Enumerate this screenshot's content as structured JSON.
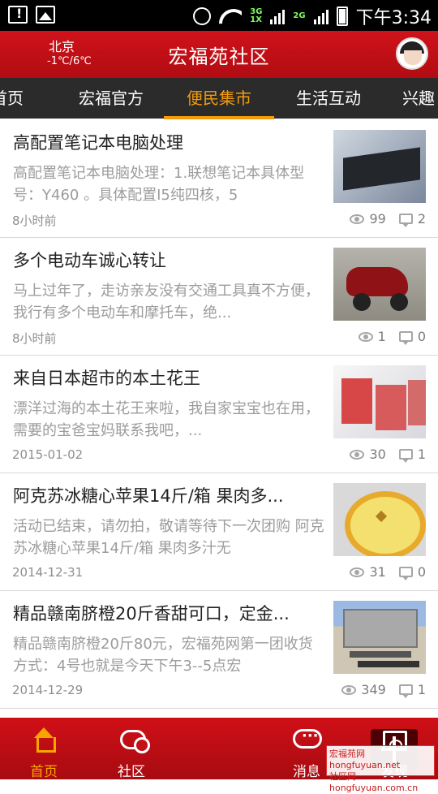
{
  "status_bar": {
    "time": "下午3:34",
    "network_a": "3G",
    "network_b": "1X",
    "network_c": "2G"
  },
  "header": {
    "city": "北京",
    "temperature": "-1℃/6℃",
    "title": "宏福苑社区"
  },
  "tabs": [
    {
      "label": "首页"
    },
    {
      "label": "宏福官方"
    },
    {
      "label": "便民集市",
      "active": true
    },
    {
      "label": "生活互动"
    },
    {
      "label": "兴趣"
    }
  ],
  "posts": [
    {
      "title": "高配置笔记本电脑处理",
      "desc": "高配置笔记本电脑处理：1.联想笔记本具体型号：Y460 。具体配置I5纯四核，5",
      "date": "8小时前",
      "views": "99",
      "comments": "2",
      "image_icon": "laptop-image"
    },
    {
      "title": "多个电动车诚心转让",
      "desc": "马上过年了，走访亲友没有交通工具真不方便，我行有多个电动车和摩托车，绝...",
      "date": "8小时前",
      "views": "1",
      "comments": "0",
      "image_icon": "scooter-image"
    },
    {
      "title": "来自日本超市的本土花王",
      "desc": "漂洋过海的本土花王来啦，我自家宝宝也在用，需要的宝爸宝妈联系我吧，...",
      "date": "2015-01-02",
      "views": "30",
      "comments": "1",
      "image_icon": "boxes-image"
    },
    {
      "title": "阿克苏冰糖心苹果14斤/箱 果肉多...",
      "desc": "活动已结束，请勿拍，敬请等待下一次团购 阿克苏冰糖心苹果14斤/箱 果肉多汁无",
      "date": "2014-12-31",
      "views": "31",
      "comments": "0",
      "image_icon": "apple-image"
    },
    {
      "title": "精品赣南脐橙20斤香甜可口，定金...",
      "desc": "精品赣南脐橙20斤80元，宏福苑网第一团收货方式：4号也就是今天下午3--5点宏",
      "date": "2014-12-29",
      "views": "349",
      "comments": "1",
      "image_icon": "street-image"
    }
  ],
  "bottom_nav": [
    {
      "label": "首页",
      "active": true
    },
    {
      "label": "社区"
    },
    {
      "label": ""
    },
    {
      "label": "消息"
    },
    {
      "label": "发现"
    }
  ],
  "watermark": {
    "line1": "宏福苑网 hongfuyuan.net",
    "line2": "社区网hongfuyuan.com.cn"
  },
  "colors": {
    "brand_red": "#c1121a",
    "active_orange": "#f39b0d",
    "tab_bar": "#2b2b2b"
  }
}
